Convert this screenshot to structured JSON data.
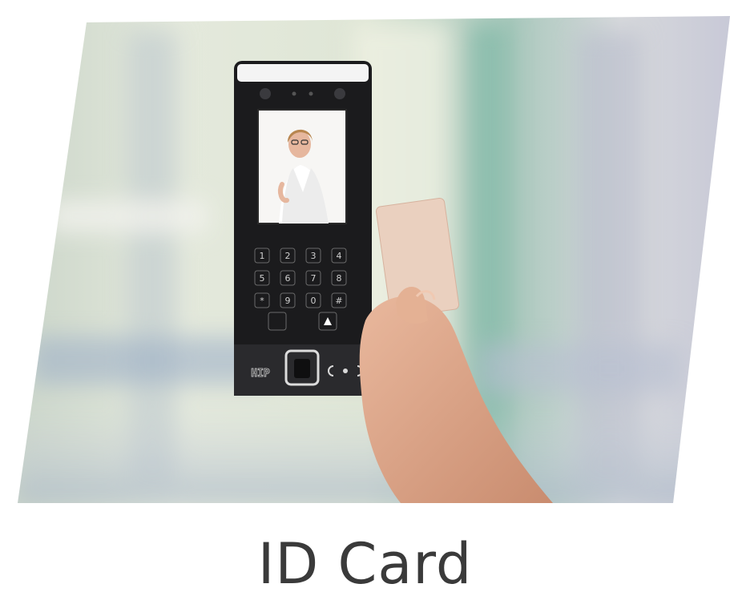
{
  "caption": "ID Card",
  "device": {
    "brand_logo": "HIP",
    "keypad": [
      "1",
      "2",
      "3",
      "4",
      "5",
      "6",
      "7",
      "8",
      "*",
      "9",
      "0",
      "#"
    ],
    "icons": [
      "camera-icon",
      "fingerprint-sensor-icon",
      "rfid-wave-icon",
      "bell-icon"
    ]
  },
  "colors": {
    "caption": "#3a3a3a",
    "device_body": "#1b1b1d",
    "card": "#e9c9b4"
  }
}
